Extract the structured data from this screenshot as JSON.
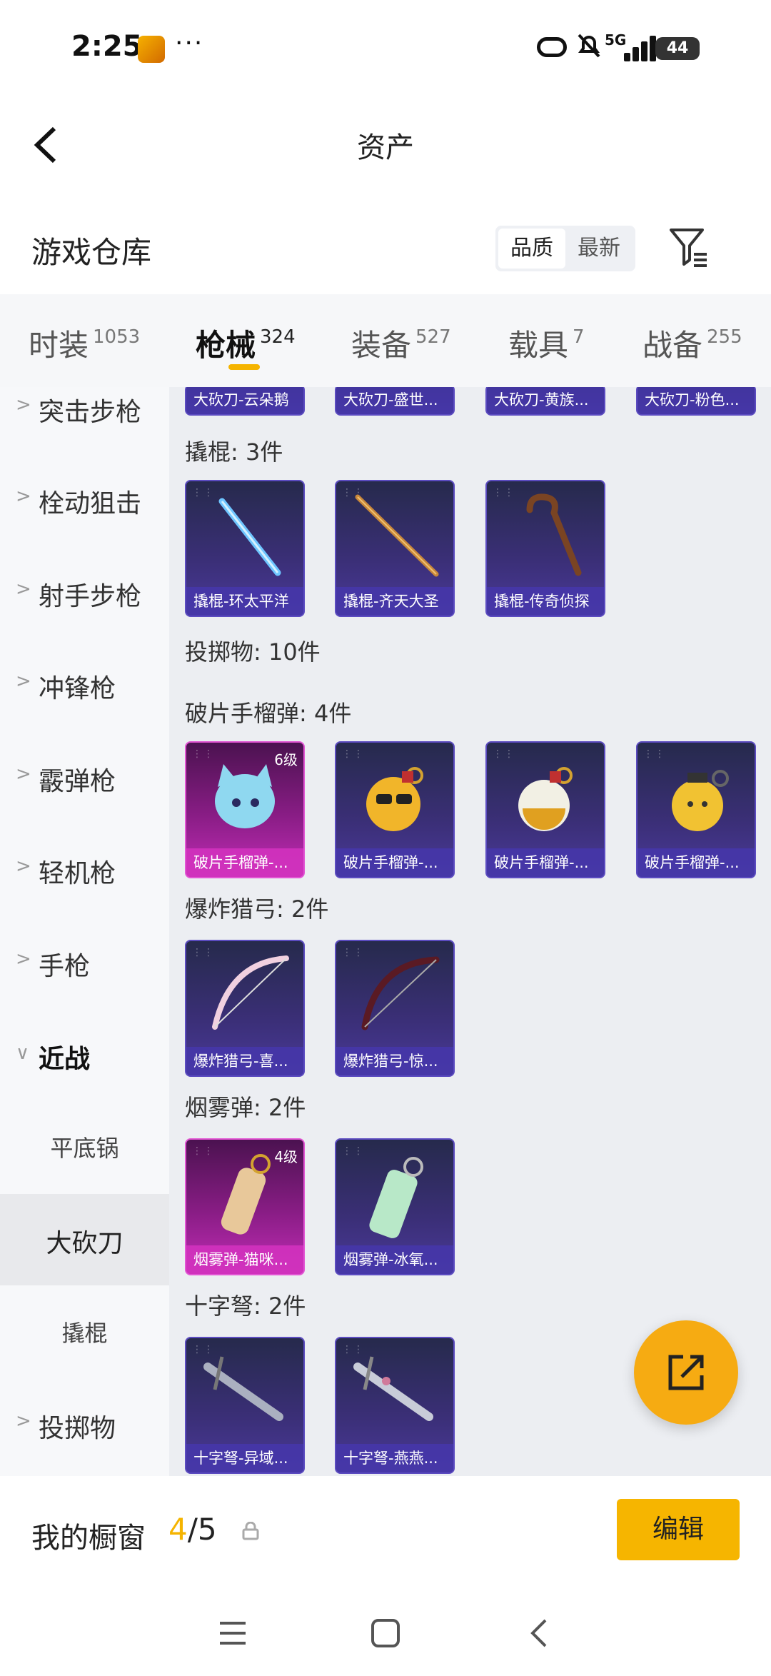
{
  "status_bar": {
    "time": "2:25",
    "dots": "···",
    "network": "5G",
    "battery": "44",
    "icons": [
      "app-icon",
      "link-icon",
      "bell-off-icon",
      "signal-icon",
      "battery-icon"
    ]
  },
  "title_bar": {
    "title": "资产",
    "back_icon": "chevron-left-icon"
  },
  "warehouse": {
    "title": "游戏仓库",
    "sort_options": [
      "品质",
      "最新"
    ],
    "sort_selected": "品质",
    "filter_icon": "filter-icon"
  },
  "tabs": [
    {
      "label": "时装",
      "count": "1053"
    },
    {
      "label": "枪械",
      "count": "324"
    },
    {
      "label": "装备",
      "count": "527"
    },
    {
      "label": "载具",
      "count": "7"
    },
    {
      "label": "战备",
      "count": "255"
    }
  ],
  "active_tab": "枪械",
  "accent_color": "#f5b400",
  "sidebar": {
    "items": [
      {
        "label": "突击步枪",
        "type": "category"
      },
      {
        "label": "栓动狙击",
        "type": "category"
      },
      {
        "label": "射手步枪",
        "type": "category"
      },
      {
        "label": "冲锋枪",
        "type": "category"
      },
      {
        "label": "霰弹枪",
        "type": "category"
      },
      {
        "label": "轻机枪",
        "type": "category"
      },
      {
        "label": "手枪",
        "type": "category"
      },
      {
        "label": "近战",
        "type": "category-expanded"
      },
      {
        "label": "平底锅",
        "type": "sub"
      },
      {
        "label": "大砍刀",
        "type": "sub-selected"
      },
      {
        "label": "撬棍",
        "type": "sub"
      },
      {
        "label": "投掷物",
        "type": "category"
      }
    ]
  },
  "content": {
    "top_row_partial": [
      "大砍刀-云朵鹅",
      "大砍刀-盛世...",
      "大砍刀-黄族...",
      "大砍刀-粉色..."
    ],
    "sections": [
      {
        "title": "撬棍: 3件",
        "items": [
          {
            "name": "撬棍-环太平洋",
            "rarity": "purple",
            "level": ""
          },
          {
            "name": "撬棍-齐天大圣",
            "rarity": "purple",
            "level": ""
          },
          {
            "name": "撬棍-传奇侦探",
            "rarity": "purple",
            "level": ""
          }
        ]
      },
      {
        "title": "投掷物: 10件",
        "items": []
      },
      {
        "title": "破片手榴弹: 4件",
        "items": [
          {
            "name": "破片手榴弹-...",
            "rarity": "pink",
            "level": "6级"
          },
          {
            "name": "破片手榴弹-...",
            "rarity": "purple",
            "level": ""
          },
          {
            "name": "破片手榴弹-...",
            "rarity": "purple",
            "level": ""
          },
          {
            "name": "破片手榴弹-...",
            "rarity": "purple",
            "level": ""
          }
        ]
      },
      {
        "title": "爆炸猎弓: 2件",
        "items": [
          {
            "name": "爆炸猎弓-喜...",
            "rarity": "purple",
            "level": ""
          },
          {
            "name": "爆炸猎弓-惊...",
            "rarity": "purple",
            "level": ""
          }
        ]
      },
      {
        "title": "烟雾弹: 2件",
        "items": [
          {
            "name": "烟雾弹-猫咪...",
            "rarity": "pink",
            "level": "4级"
          },
          {
            "name": "烟雾弹-冰氧...",
            "rarity": "purple",
            "level": ""
          }
        ]
      },
      {
        "title": "十字弩: 2件",
        "items": [
          {
            "name": "十字弩-异域...",
            "rarity": "purple",
            "level": ""
          },
          {
            "name": "十字弩-燕燕...",
            "rarity": "purple",
            "level": ""
          }
        ]
      }
    ]
  },
  "fab": {
    "icon": "share-external-icon"
  },
  "showcase": {
    "label": "我的橱窗",
    "current": "4",
    "total": "/5",
    "lock_icon": "lock-icon",
    "edit_label": "编辑"
  },
  "nav_bar": {
    "icons": [
      "menu-icon",
      "home-square-icon",
      "back-icon"
    ]
  }
}
